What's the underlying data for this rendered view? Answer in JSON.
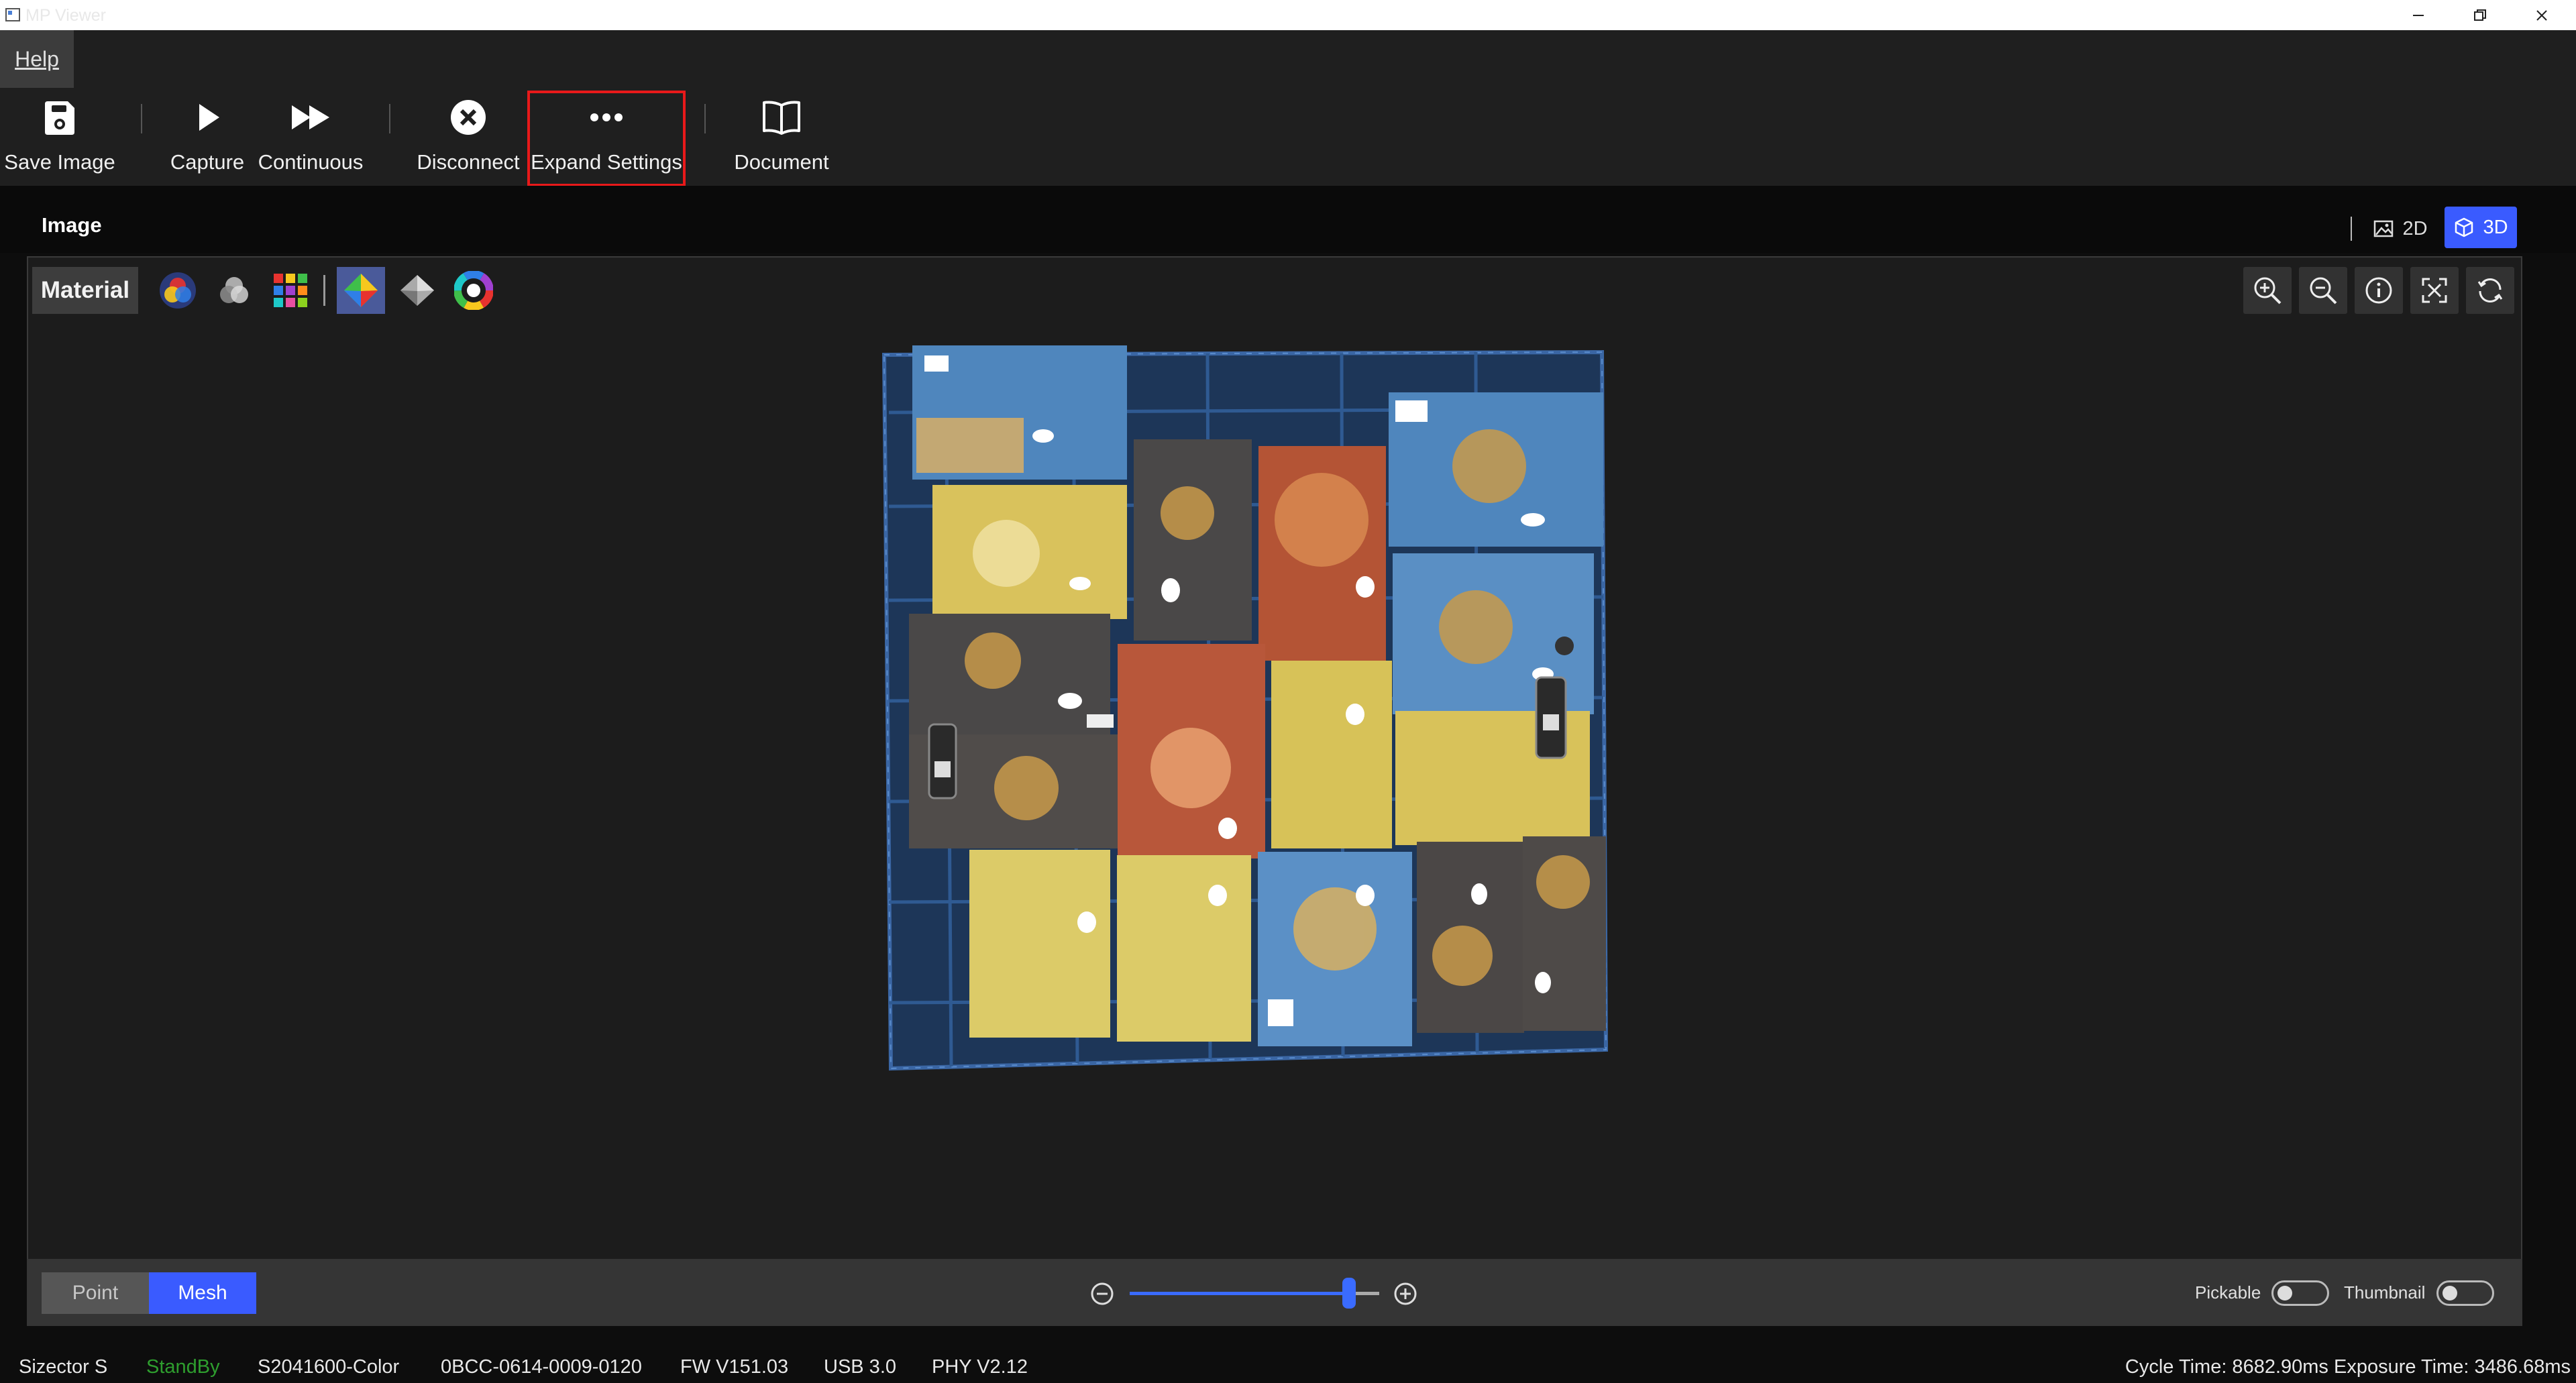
{
  "window": {
    "title": "MP Viewer"
  },
  "menu": {
    "help": "Help"
  },
  "toolbar": {
    "save_image": "Save Image",
    "capture": "Capture",
    "continuous": "Continuous",
    "disconnect": "Disconnect",
    "expand_settings": "Expand Settings",
    "document": "Document"
  },
  "image_panel": {
    "title": "Image",
    "view_2d": "2D",
    "view_3d": "3D",
    "active_view": "3D"
  },
  "viewer": {
    "material_label": "Material",
    "material_modes": [
      "rgb-color-icon",
      "gray-color-icon",
      "palette-grid-icon",
      "colored-surface-icon",
      "gray-surface-icon",
      "color-wheel-icon"
    ],
    "active_material": "colored-surface-icon",
    "tools": [
      "zoom-in-icon",
      "zoom-out-icon",
      "info-icon",
      "fit-view-icon",
      "reset-view-icon"
    ]
  },
  "bottom_bar": {
    "point": "Point",
    "mesh": "Mesh",
    "active_render": "Mesh",
    "point_size_level": 0.88,
    "pickable": "Pickable",
    "pickable_on": false,
    "thumbnail": "Thumbnail",
    "thumbnail_on": false
  },
  "status": {
    "device": "Sizector S",
    "state": "StandBy",
    "model": "S2041600-Color",
    "serial": "0BCC-0614-0009-0120",
    "fw": "FW V151.03",
    "usb": "USB 3.0",
    "phy": "PHY V2.12",
    "timing": "Cycle Time: 8682.90ms Exposure Time: 3486.68ms"
  },
  "colors": {
    "accent": "#3a5bff",
    "highlight": "#e8191a",
    "standby": "#2e9e2e",
    "background": "#1c1c1c"
  }
}
